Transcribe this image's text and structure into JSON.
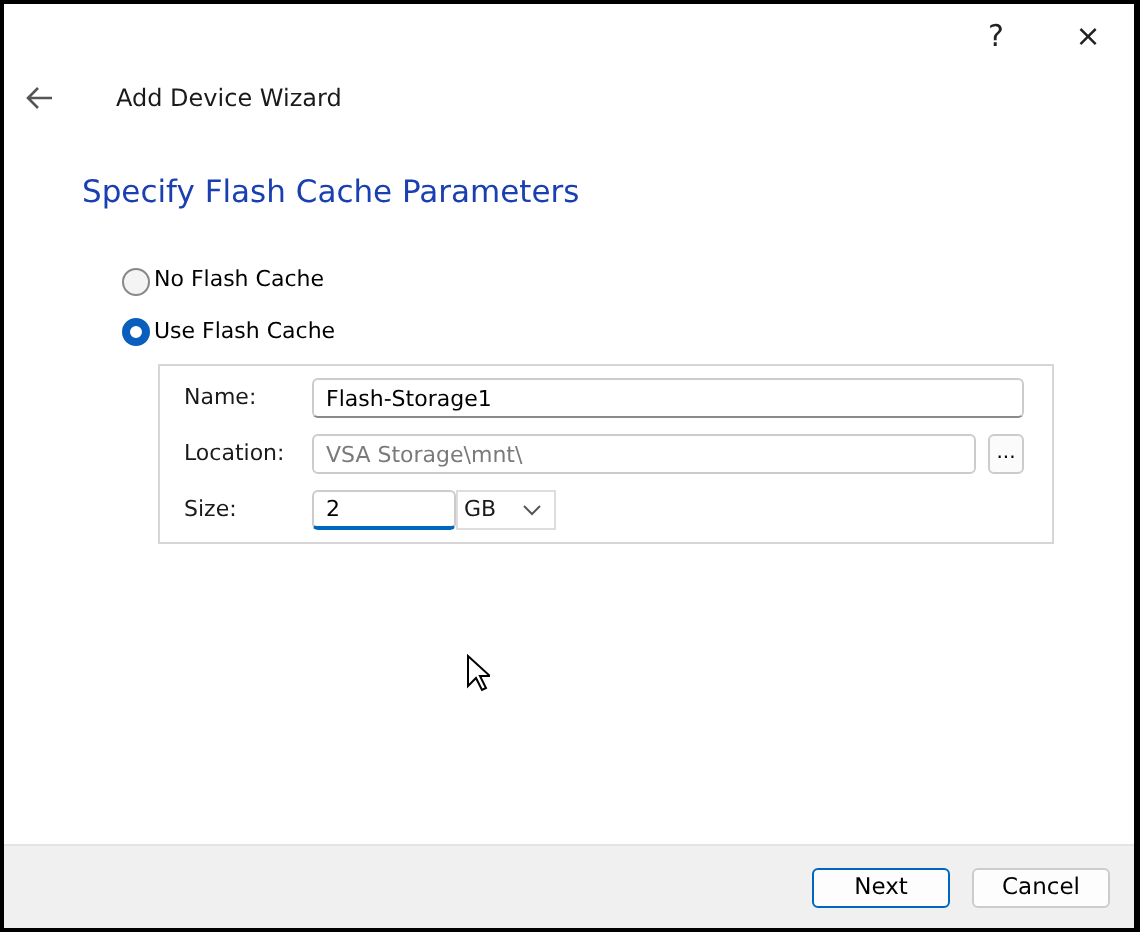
{
  "window": {
    "help": "?",
    "close": "×"
  },
  "header": {
    "title": "Add Device Wizard"
  },
  "heading": "Specify Flash Cache Parameters",
  "options": [
    {
      "label": "No Flash Cache",
      "selected": false
    },
    {
      "label": "Use Flash Cache",
      "selected": true
    }
  ],
  "fields": [
    {
      "kind": "text",
      "label": "Name:",
      "value": "Flash-Storage1",
      "focused": false
    },
    {
      "kind": "path",
      "label": "Location:",
      "value": "VSA Storage\\mnt\\",
      "disabled": true,
      "browse": "..."
    },
    {
      "kind": "size",
      "label": "Size:",
      "value": "2",
      "focused": true,
      "unit": "GB"
    }
  ],
  "buttons": [
    {
      "label": "Next",
      "default": true
    },
    {
      "label": "Cancel",
      "default": false
    }
  ]
}
